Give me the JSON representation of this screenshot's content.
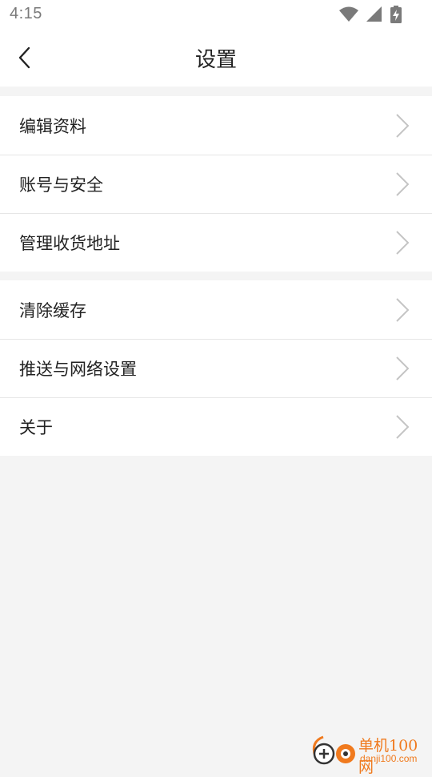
{
  "status_bar": {
    "time": "4:15",
    "icons": [
      "wifi-icon",
      "signal-icon",
      "battery-charging-icon"
    ]
  },
  "header": {
    "back_icon": "chevron-left-icon",
    "title": "设置"
  },
  "settings_groups": [
    {
      "items": [
        {
          "label": "编辑资料",
          "icon": "chevron-right-icon"
        },
        {
          "label": "账号与安全",
          "icon": "chevron-right-icon"
        },
        {
          "label": "管理收货地址",
          "icon": "chevron-right-icon"
        }
      ]
    },
    {
      "items": [
        {
          "label": "清除缓存",
          "icon": "chevron-right-icon"
        },
        {
          "label": "推送与网络设置",
          "icon": "chevron-right-icon"
        },
        {
          "label": "关于",
          "icon": "chevron-right-icon"
        }
      ]
    }
  ],
  "watermark": {
    "name": "单机100网",
    "domain": "danji100.com",
    "color": "#f07a1e"
  },
  "colors": {
    "background": "#f4f4f4",
    "surface": "#ffffff",
    "divider": "#e6e6e6",
    "chevron": "#c4c4c4"
  }
}
